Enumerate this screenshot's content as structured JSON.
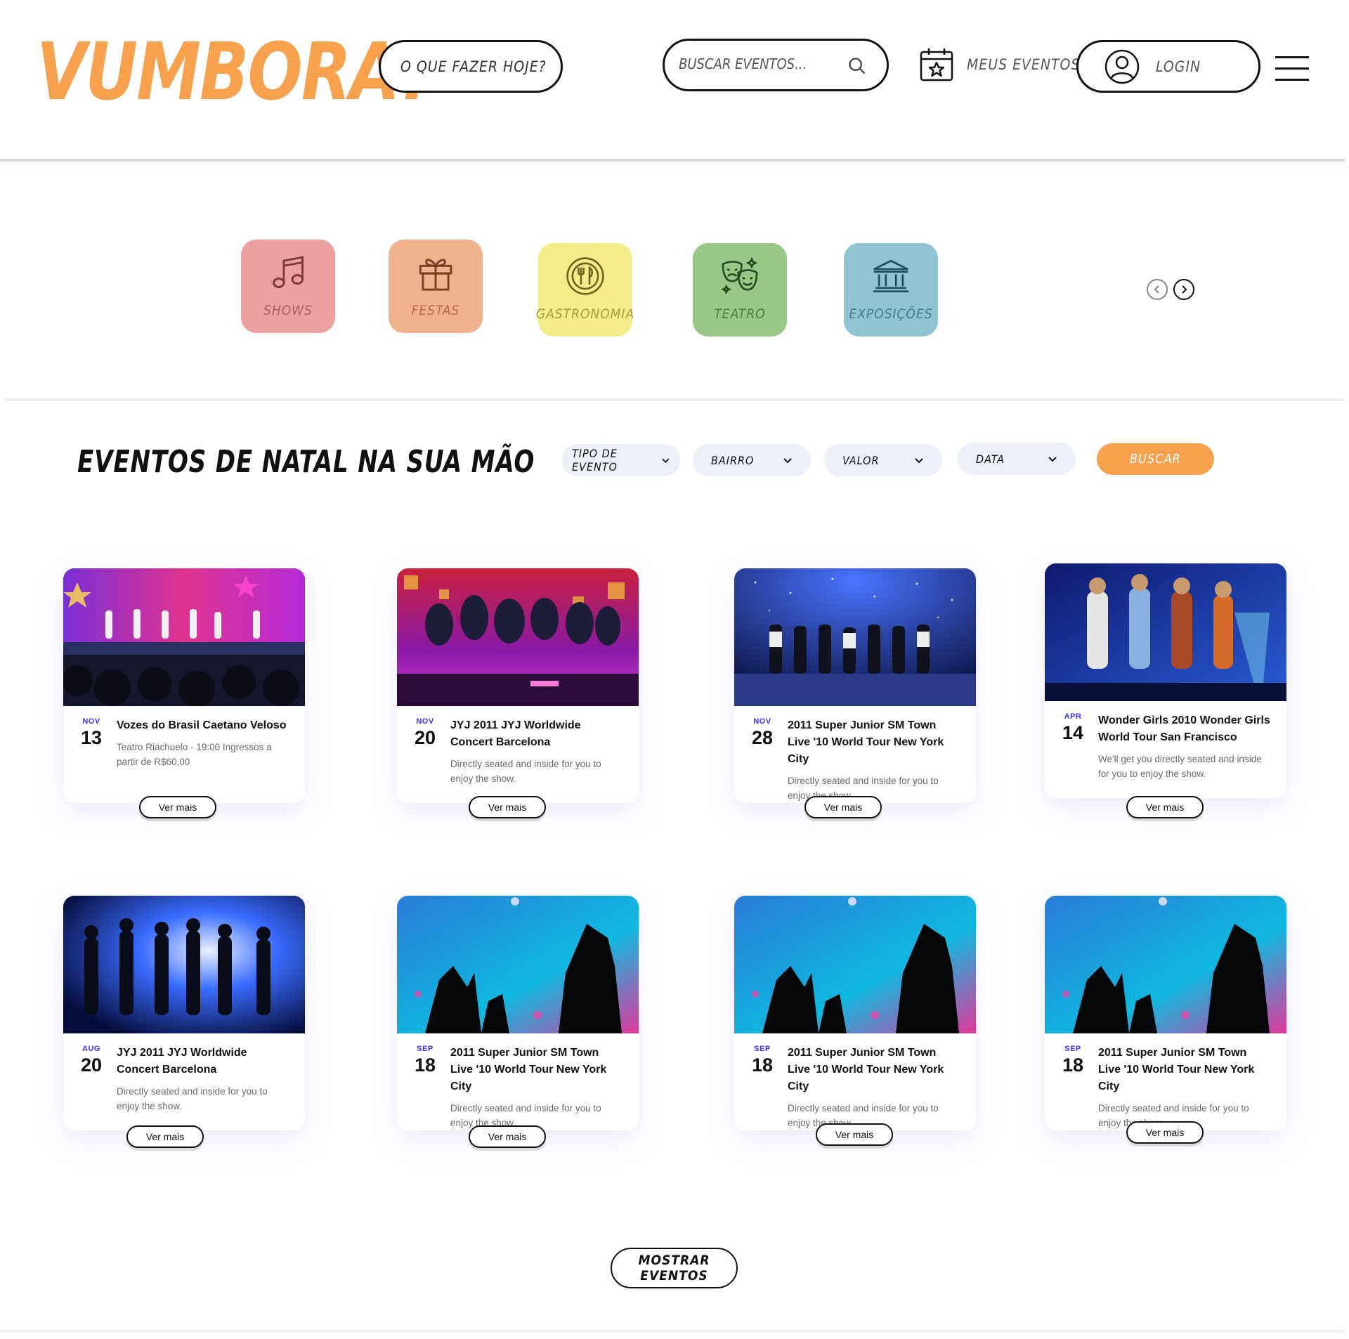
{
  "header": {
    "logo": "VUMBORA?",
    "what_to_do": "O QUE FAZER HOJE?",
    "search_placeholder": "BUSCAR EVENTOS...",
    "my_events": "MEUS EVENTOS",
    "login": "LOGIN"
  },
  "categories": [
    {
      "label": "SHOWS",
      "icon": "music-note-icon",
      "color": "#ee9fa0"
    },
    {
      "label": "FESTAS",
      "icon": "gift-icon",
      "color": "#f0b28e"
    },
    {
      "label": "GASTRONOMIA",
      "icon": "plate-cutlery-icon",
      "color": "#f2ec8a"
    },
    {
      "label": "TEATRO",
      "icon": "theater-masks-icon",
      "color": "#98c788"
    },
    {
      "label": "EXPOSIÇÕES",
      "icon": "museum-icon",
      "color": "#8fc3d2"
    }
  ],
  "section": {
    "title": "EVENTOS DE NATAL NA SUA MÃO",
    "filters": [
      "TIPO DE EVENTO",
      "BAIRRO",
      "VALOR",
      "DATA"
    ],
    "search_button": "BUSCAR"
  },
  "events": [
    {
      "month": "NOV",
      "day": "13",
      "title": "Vozes do Brasil Caetano Veloso",
      "desc": "Teatro Riachuelo - 19:00 Ingressos a partir de R$60,00",
      "cta": "Ver mais"
    },
    {
      "month": "NOV",
      "day": "20",
      "title": "JYJ 2011 JYJ Worldwide Concert Barcelona",
      "desc": "Directly seated and inside for you to enjoy the show.",
      "cta": "Ver mais"
    },
    {
      "month": "NOV",
      "day": "28",
      "title": "2011 Super Junior SM Town Live '10 World Tour New York City",
      "desc": "Directly seated and inside for you to enjoy the show.",
      "cta": "Ver mais"
    },
    {
      "month": "APR",
      "day": "14",
      "title": "Wonder Girls 2010 Wonder Girls World Tour San Francisco",
      "desc": "We'll get you directly seated and inside for you to enjoy the show.",
      "cta": "Ver mais"
    },
    {
      "month": "AUG",
      "day": "20",
      "title": "JYJ 2011 JYJ Worldwide Concert Barcelona",
      "desc": "Directly seated and inside for you to enjoy the show.",
      "cta": "Ver mais"
    },
    {
      "month": "SEP",
      "day": "18",
      "title": "2011 Super Junior SM Town Live '10 World Tour New York City",
      "desc": "Directly seated and inside for you to enjoy the show.",
      "cta": "Ver mais"
    },
    {
      "month": "SEP",
      "day": "18",
      "title": "2011 Super Junior SM Town Live '10 World Tour New York City",
      "desc": "Directly seated and inside for you to enjoy the show.",
      "cta": "Ver mais"
    },
    {
      "month": "SEP",
      "day": "18",
      "title": "2011 Super Junior SM Town Live '10 World Tour New York City",
      "desc": "Directly seated and inside for you to enjoy the show.",
      "cta": "Ver mais"
    }
  ],
  "show_more": "MOSTRAR EVENTOS",
  "colors": {
    "accent": "#f7a04e",
    "date_month": "#3d37f1",
    "filter_bg": "#eef0f9"
  }
}
